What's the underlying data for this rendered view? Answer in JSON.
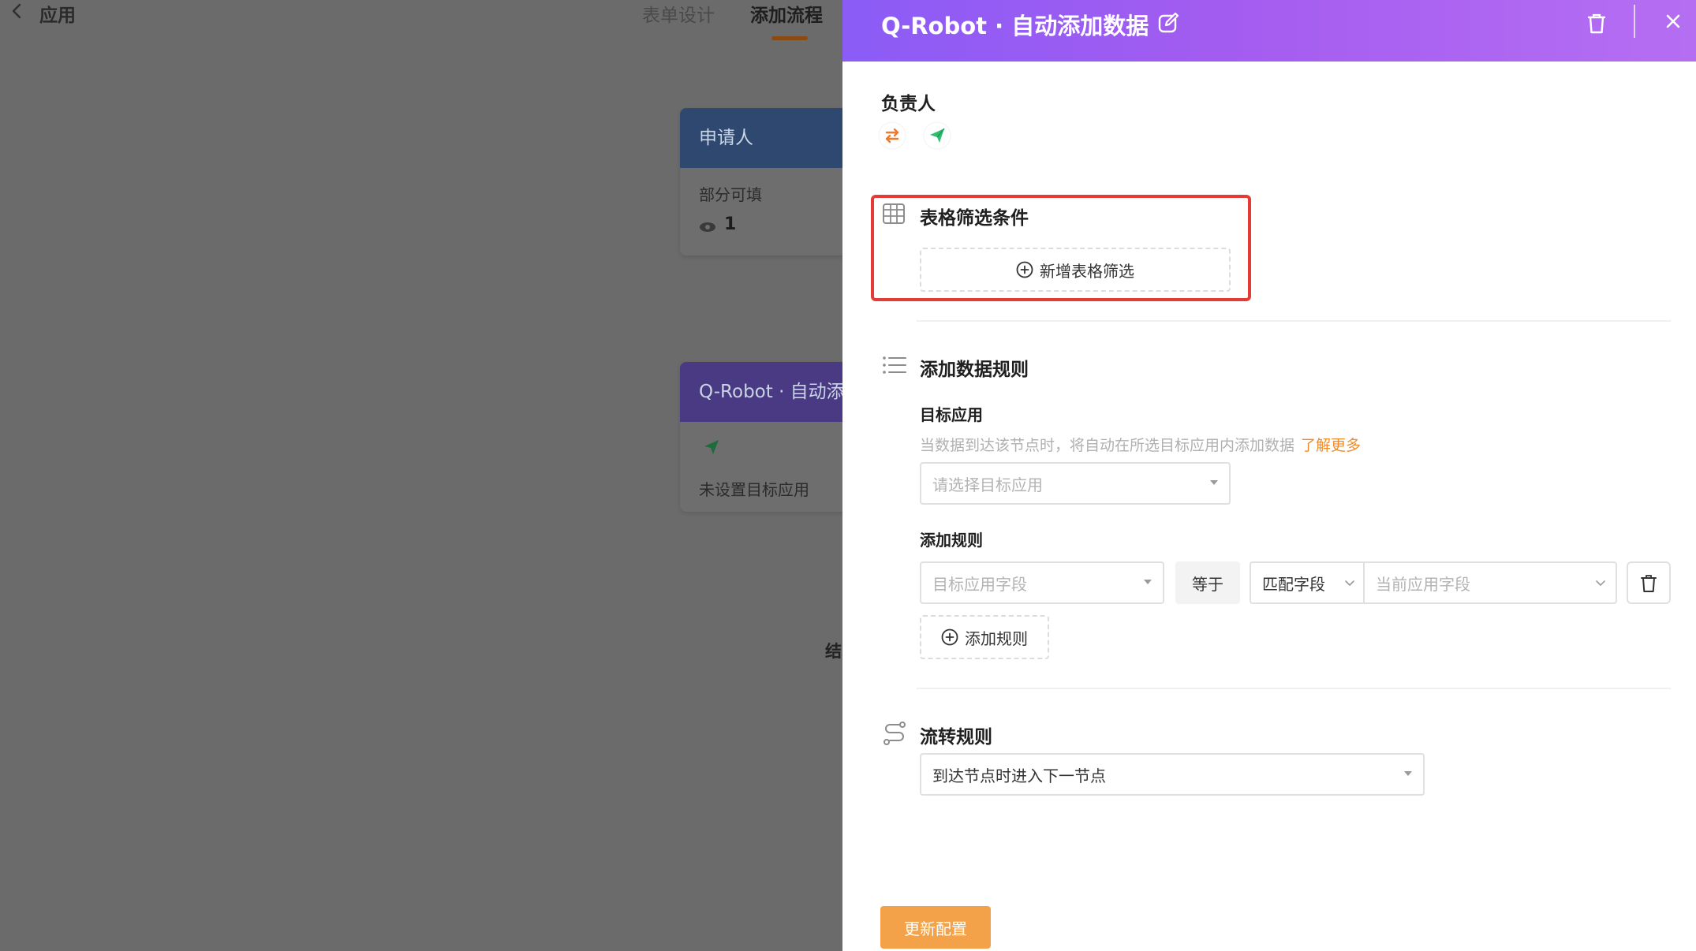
{
  "background": {
    "app_title": "应用",
    "tabs": [
      {
        "label": "表单设计"
      },
      {
        "label": "添加流程"
      }
    ],
    "nodes": {
      "applicant": {
        "title": "申请人",
        "subtitle": "部分可填",
        "count": "1"
      },
      "robot": {
        "title": "Q-Robot · 自动添",
        "status": "未设置目标应用"
      }
    },
    "end_label": "结"
  },
  "drawer": {
    "title": "Q-Robot · 自动添加数据",
    "owner_label": "负责人",
    "filter_section": {
      "title": "表格筛选条件",
      "add_button": "新增表格筛选"
    },
    "rules_section": {
      "title": "添加数据规则",
      "target_label": "目标应用",
      "hint": "当数据到达该节点时，将自动在所选目标应用内添加数据",
      "learn_more": "了解更多",
      "target_placeholder": "请选择目标应用",
      "add_rule_label": "添加规则",
      "target_field_placeholder": "目标应用字段",
      "equals_label": "等于",
      "match_value": "匹配字段",
      "current_field_placeholder": "当前应用字段",
      "add_rule_button": "添加规则"
    },
    "flow_section": {
      "title": "流转规则",
      "value": "到达节点时进入下一节点"
    },
    "update_button": "更新配置"
  },
  "colors": {
    "header_gradient_start": "#8b5cf6",
    "header_gradient_end": "#b56ef2",
    "highlight_border": "#e33b35",
    "accent_orange": "#f08c2b",
    "update_button": "#f3a24a"
  }
}
